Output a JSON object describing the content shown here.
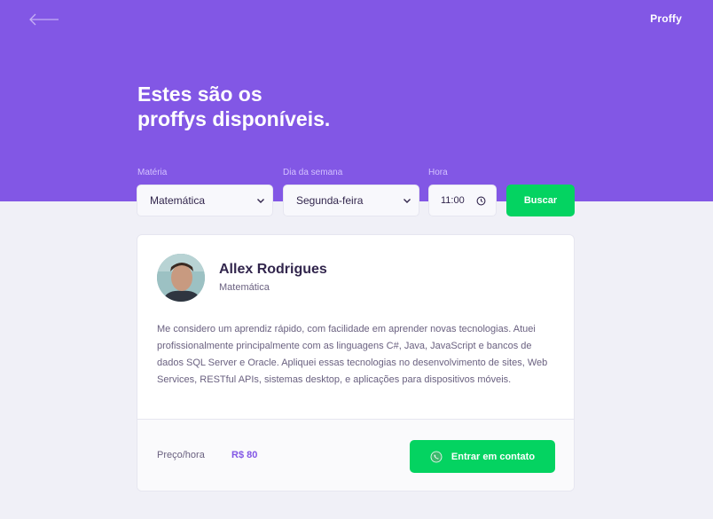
{
  "header": {
    "logo": "Proffy",
    "title_line1": "Estes são os",
    "title_line2": "proffys disponíveis."
  },
  "filters": {
    "subject_label": "Matéria",
    "subject_value": "Matemática",
    "weekday_label": "Dia da semana",
    "weekday_value": "Segunda-feira",
    "time_label": "Hora",
    "time_value": "11:00",
    "search_label": "Buscar"
  },
  "teacher": {
    "name": "Allex Rodrigues",
    "subject": "Matemática",
    "bio": "Me considero um aprendiz rápido, com facilidade em aprender novas tecnologias. Atuei profissionalmente principalmente com as linguagens C#, Java, JavaScript e bancos de dados SQL Server e Oracle. Apliquei essas tecnologias no desenvolvimento de sites, Web Services, RESTful APIs, sistemas desktop, e aplicações para dispositivos móveis.",
    "price_label": "Preço/hora",
    "price_value": "R$ 80",
    "contact_label": "Entrar em contato"
  },
  "colors": {
    "primary": "#8257E5",
    "secondary": "#04D361",
    "background": "#F0F0F7"
  },
  "icons": {
    "back": "arrow-left-icon",
    "chevron": "chevron-down-icon",
    "clock": "clock-icon",
    "whatsapp": "whatsapp-icon"
  }
}
